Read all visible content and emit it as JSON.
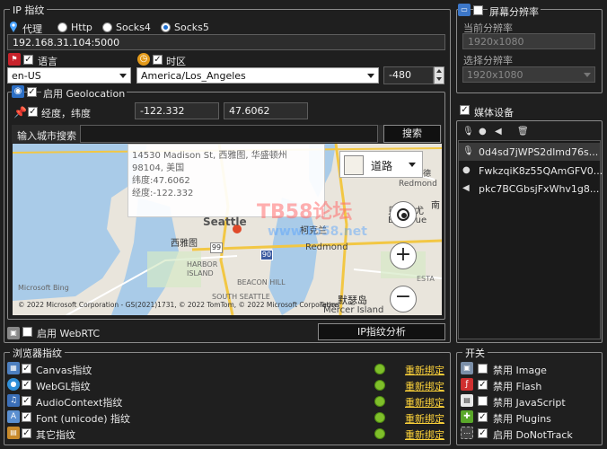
{
  "ip_group": {
    "title": "IP 指纹",
    "proxy_label": "代理",
    "protocols": [
      "Http",
      "Socks4",
      "Socks5"
    ],
    "selected_protocol": "Socks5",
    "proxy_value": "192.168.31.104:5000"
  },
  "language": {
    "label": "语言",
    "value": "en-US",
    "checked": true
  },
  "timezone": {
    "label": "时区",
    "value": "America/Los_Angeles",
    "offset": "-480",
    "checked": true
  },
  "geo": {
    "title": "启用 Geolocation",
    "coords_label": "经度，纬度",
    "longitude": "-122.332",
    "latitude": "47.6062",
    "search_label": "输入城市搜索",
    "search_value": "",
    "search_button": "搜索"
  },
  "map": {
    "address_line1": "14530 Madison St, 西雅图, 华盛顿州",
    "address_line2": "98104, 美国",
    "lat_line": "纬度:47.6062",
    "lng_line": "经度:-122.332",
    "mode_label": "道路",
    "place_seattle": "Seattle",
    "place_seattle_cn": "西雅图",
    "place_redmond": "雷德蒙德",
    "place_redmond_en": "Redmond",
    "place_bellevue_cn": "贝尔维尤",
    "place_bellevue": "Bellevue",
    "place_kirkland_cn": "柯克兰",
    "place_mercer_cn": "默瑟岛",
    "place_mercer": "Mercer Island",
    "place_harbor": "HARBOR ISLAND",
    "place_south_seattle": "SOUTH SEATTLE",
    "place_beacon": "BEACON HILL",
    "place_esta": "ESTA",
    "place_south_cn": "南",
    "highway_1": "99",
    "highway_2": "90",
    "brand": "Microsoft Bing",
    "copyright": "© 2022 Microsoft Corporation - GS(2021)1731, © 2022 TomTom, © 2022 Microsoft Corporation",
    "terms": "Terms",
    "watermark_1": "TB58论坛",
    "watermark_2": "www.tb58.net"
  },
  "webrtc": {
    "label": "启用 WebRTC",
    "checked": false
  },
  "ip_analysis_button": "IP指纹分析",
  "resolution": {
    "title": "屏幕分辨率",
    "current_label": "当前分辨率",
    "current_value": "1920x1080",
    "select_label": "选择分辨率",
    "select_value": "1920x1080"
  },
  "media": {
    "title": "媒体设备",
    "devices": [
      "0d4sd7jWPS2dlmd76s...",
      "FwkzqiK8z55QAmGFV0...",
      "pkc7BCGbsjFxWhv1g8..."
    ]
  },
  "browser": {
    "title": "浏览器指纹",
    "rebind_label": "重新绑定",
    "items": [
      "Canvas指纹",
      "WebGL指纹",
      "AudioContext指纹",
      "Font (unicode) 指纹",
      "其它指纹"
    ]
  },
  "switches": {
    "title": "开关",
    "items": [
      {
        "label": "禁用 Image",
        "checked": false
      },
      {
        "label": "禁用 Flash",
        "checked": true
      },
      {
        "label": "禁用 JavaScript",
        "checked": false
      },
      {
        "label": "禁用 Plugins",
        "checked": true
      },
      {
        "label": "启用 DoNotTrack",
        "checked": true
      }
    ]
  },
  "colors": {
    "link": "#ffd43a",
    "accent_blue": "#1e6fd0",
    "status_ok": "#7fbf2a"
  }
}
